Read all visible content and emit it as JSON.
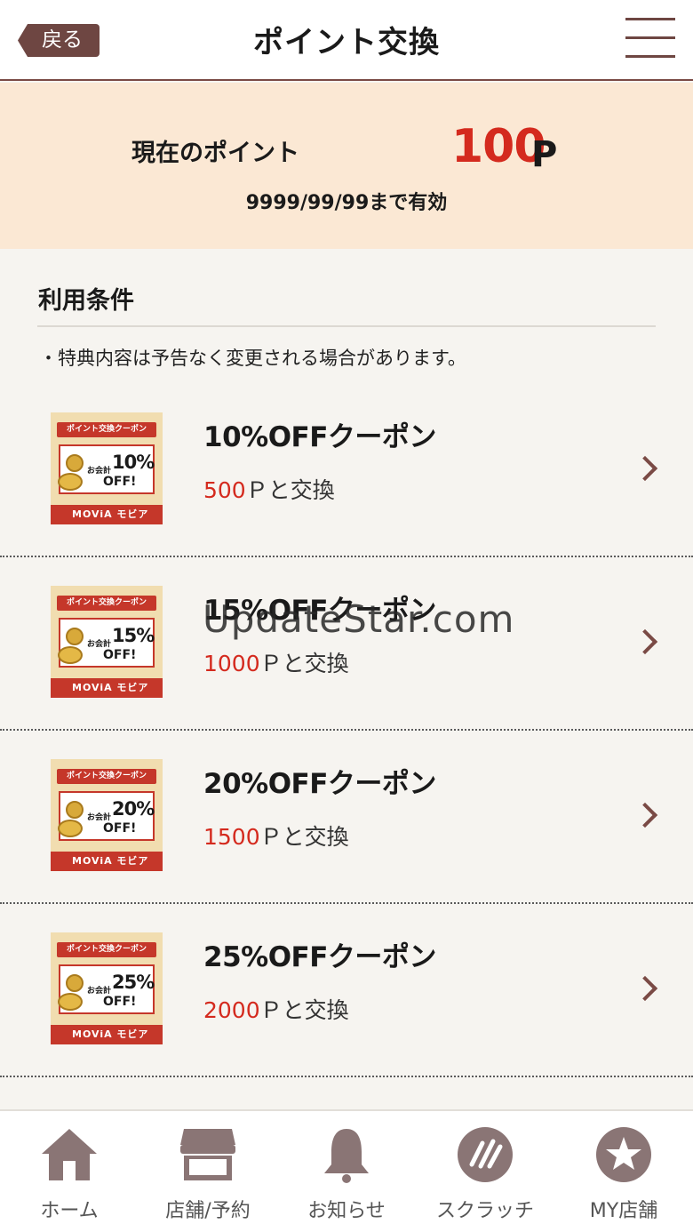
{
  "header": {
    "back_label": "戻る",
    "title": "ポイント交換"
  },
  "points": {
    "label": "現在のポイント",
    "value": "100",
    "unit": "P",
    "expiry": "9999/99/99まで有効"
  },
  "conditions": {
    "title": "利用条件",
    "note": "・特典内容は予告なく変更される場合があります。"
  },
  "coupons": [
    {
      "name": "10%OFFクーポン",
      "cost": "500",
      "cost_suffix": "Ｐと交換",
      "thumb_pct": "10%"
    },
    {
      "name": "15%OFFクーポン",
      "cost": "1000",
      "cost_suffix": "Ｐと交換",
      "thumb_pct": "15%"
    },
    {
      "name": "20%OFFクーポン",
      "cost": "1500",
      "cost_suffix": "Ｐと交換",
      "thumb_pct": "20%"
    },
    {
      "name": "25%OFFクーポン",
      "cost": "2000",
      "cost_suffix": "Ｐと交換",
      "thumb_pct": "25%"
    }
  ],
  "thumb": {
    "top": "ポイント交換クーポン",
    "small": "お会計",
    "off": "OFF!",
    "brand": "MOViA モビア"
  },
  "watermark": "UpdateStar.com",
  "tabs": [
    {
      "label": "ホーム",
      "icon": "home-icon"
    },
    {
      "label": "店舗/予約",
      "icon": "store-icon"
    },
    {
      "label": "お知らせ",
      "icon": "bell-icon"
    },
    {
      "label": "スクラッチ",
      "icon": "scratch-icon"
    },
    {
      "label": "MY店舗",
      "icon": "star-icon"
    }
  ],
  "colors": {
    "accent": "#6e4642",
    "price_red": "#d42a1e",
    "banner_bg": "#fbe8d4"
  }
}
